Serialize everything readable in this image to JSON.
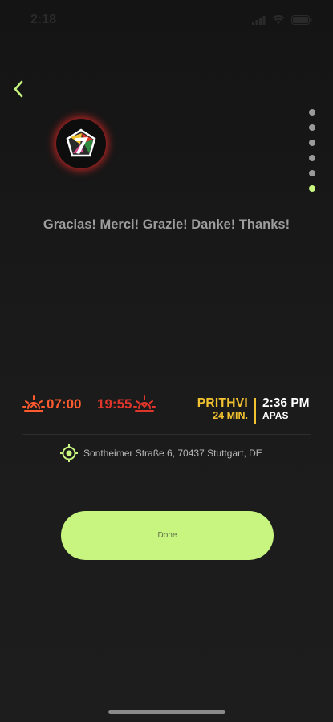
{
  "status_bar": {
    "time": "2:18",
    "icons": [
      "signal-icon",
      "wifi-icon",
      "battery-icon"
    ]
  },
  "navigation": {
    "back_icon": "chevron-left-icon"
  },
  "pager": {
    "total": 6,
    "active_index": 5
  },
  "message": "Gracias! Merci! Grazie! Danke! Thanks!",
  "sun": {
    "sunrise": "07:00",
    "sunset": "19:55"
  },
  "mode": {
    "name": "PRITHVI",
    "duration": "24 MIN."
  },
  "current": {
    "time": "2:36 PM",
    "label": "APAS"
  },
  "location": {
    "icon": "location-target-icon",
    "address": "Sontheimer Straße 6, 70437 Stuttgart, DE"
  },
  "done_button": {
    "label": "Done"
  },
  "colors": {
    "accent": "#c7f57f",
    "sunrise": "#ff5b2e",
    "sunset": "#e0352b",
    "mode": "#f2c230",
    "logo_glow": "#e62828"
  }
}
